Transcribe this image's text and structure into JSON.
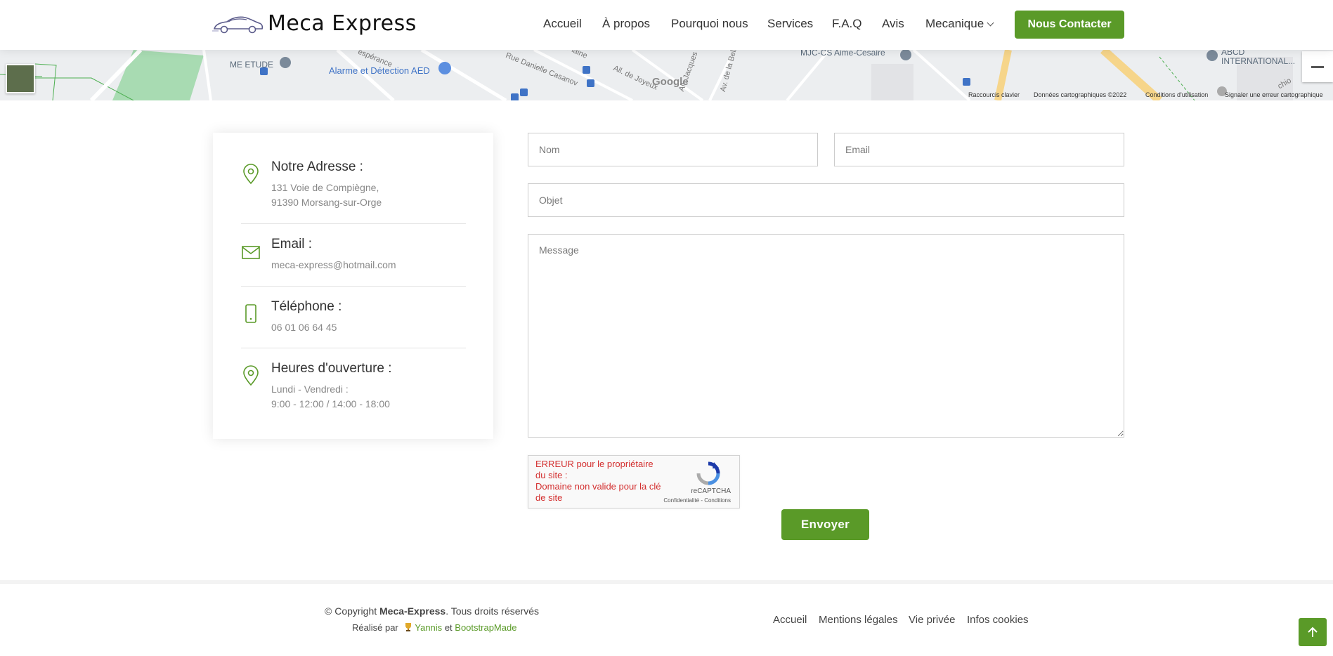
{
  "brand": {
    "name": "Meca Express"
  },
  "nav": {
    "items": [
      {
        "label": "Accueil"
      },
      {
        "label": "À propos"
      },
      {
        "label": "Pourquoi nous"
      },
      {
        "label": "Services"
      },
      {
        "label": "F.A.Q"
      },
      {
        "label": "Avis"
      },
      {
        "label": "Mecanique"
      }
    ],
    "cta_label": "Nous Contacter"
  },
  "map": {
    "labels": [
      "ME ETUDE",
      "Alarme et Détection AED",
      "MJC-CS Aime-Cesaire",
      "ABCD",
      "INTERNATIONAL...",
      "Google"
    ],
    "streets": [
      "espérance",
      "Rue Danielle Casanov",
      "Plaine",
      "All. de Joyeux",
      "All. Jacques",
      "Av. de la Belle",
      "chio"
    ],
    "attribution": [
      "Raccourcis clavier",
      "Données cartographiques ©2022",
      "Conditions d'utilisation",
      "Signaler une erreur cartographique"
    ]
  },
  "contact_info": {
    "address": {
      "title": "Notre Adresse :",
      "line1": "131 Voie de Compiègne,",
      "line2": "91390 Morsang-sur-Orge"
    },
    "email": {
      "title": "Email :",
      "value": "meca-express@hotmail.com"
    },
    "phone": {
      "title": "Téléphone :",
      "value": "06 01 06 64 45"
    },
    "hours": {
      "title": "Heures d'ouverture :",
      "line1": "Lundi - Vendredi :",
      "line2": "9:00 - 12:00 / 14:00 - 18:00"
    }
  },
  "form": {
    "name_placeholder": "Nom",
    "email_placeholder": "Email",
    "subject_placeholder": "Objet",
    "message_placeholder": "Message",
    "recaptcha_error": "ERREUR pour le propriétaire du site :\nDomaine non valide pour la clé de site",
    "recaptcha_brand": "reCAPTCHA",
    "recaptcha_links": "Confidentialité - Conditions",
    "submit_label": "Envoyer"
  },
  "footer": {
    "copyright_prefix": "© Copyright ",
    "copyright_brand": "Meca-Express",
    "copyright_suffix": ". Tous droits réservés",
    "made_by_prefix": "Réalisé par",
    "author": "Yannis",
    "and": "et",
    "template": "BootstrapMade",
    "links": [
      {
        "label": "Accueil"
      },
      {
        "label": "Mentions légales"
      },
      {
        "label": "Vie privée"
      },
      {
        "label": "Infos cookies"
      }
    ]
  },
  "colors": {
    "accent": "#5a9a28",
    "error": "#d32f2f"
  },
  "icons": [
    "car-logo-icon",
    "map-pin-icon",
    "envelope-icon",
    "phone-icon",
    "recaptcha-icon",
    "trophy-icon",
    "arrow-up-icon"
  ]
}
